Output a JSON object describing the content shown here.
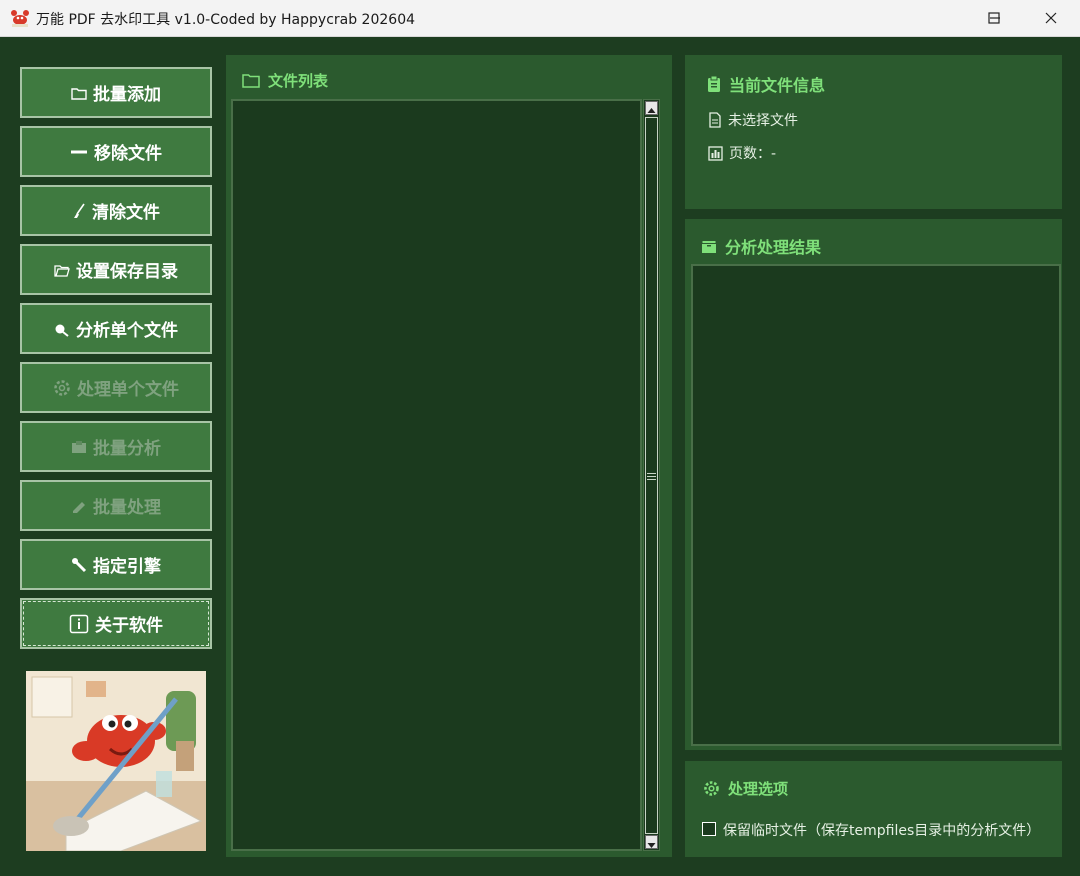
{
  "window": {
    "title": "万能 PDF 去水印工具 v1.0-Coded by Happycrab 202604",
    "controls": [
      "minimize-icon",
      "maximize-icon",
      "close-icon"
    ]
  },
  "sidebar": {
    "buttons": [
      {
        "label": "批量添加",
        "icon": "folder-icon",
        "enabled": true
      },
      {
        "label": "移除文件",
        "icon": "minus-icon",
        "enabled": true
      },
      {
        "label": "清除文件",
        "icon": "broom-icon",
        "enabled": true
      },
      {
        "label": "设置保存目录",
        "icon": "folder-open-icon",
        "enabled": true
      },
      {
        "label": "分析单个文件",
        "icon": "magnifier-icon",
        "enabled": true
      },
      {
        "label": "处理单个文件",
        "icon": "gear-icon",
        "enabled": false
      },
      {
        "label": "批量分析",
        "icon": "box-icon",
        "enabled": false
      },
      {
        "label": "批量处理",
        "icon": "pen-icon",
        "enabled": false
      },
      {
        "label": "指定引擎",
        "icon": "wrench-icon",
        "enabled": true
      },
      {
        "label": "关于软件",
        "icon": "info-icon",
        "enabled": true
      }
    ]
  },
  "file_list": {
    "title": "文件列表",
    "items": []
  },
  "current_file": {
    "title": "当前文件信息",
    "file_name": "未选择文件",
    "pages": "页数：-"
  },
  "results": {
    "title": "分析处理结果",
    "content": ""
  },
  "options": {
    "title": "处理选项",
    "keep_temp_label": "保留临时文件（保存tempfiles目录中的分析文件）",
    "keep_temp_checked": false
  },
  "colors": {
    "background": "#1d3d20",
    "panel": "#2b5a2e",
    "button": "#3f7a40",
    "accent_text": "#7fe07a"
  }
}
